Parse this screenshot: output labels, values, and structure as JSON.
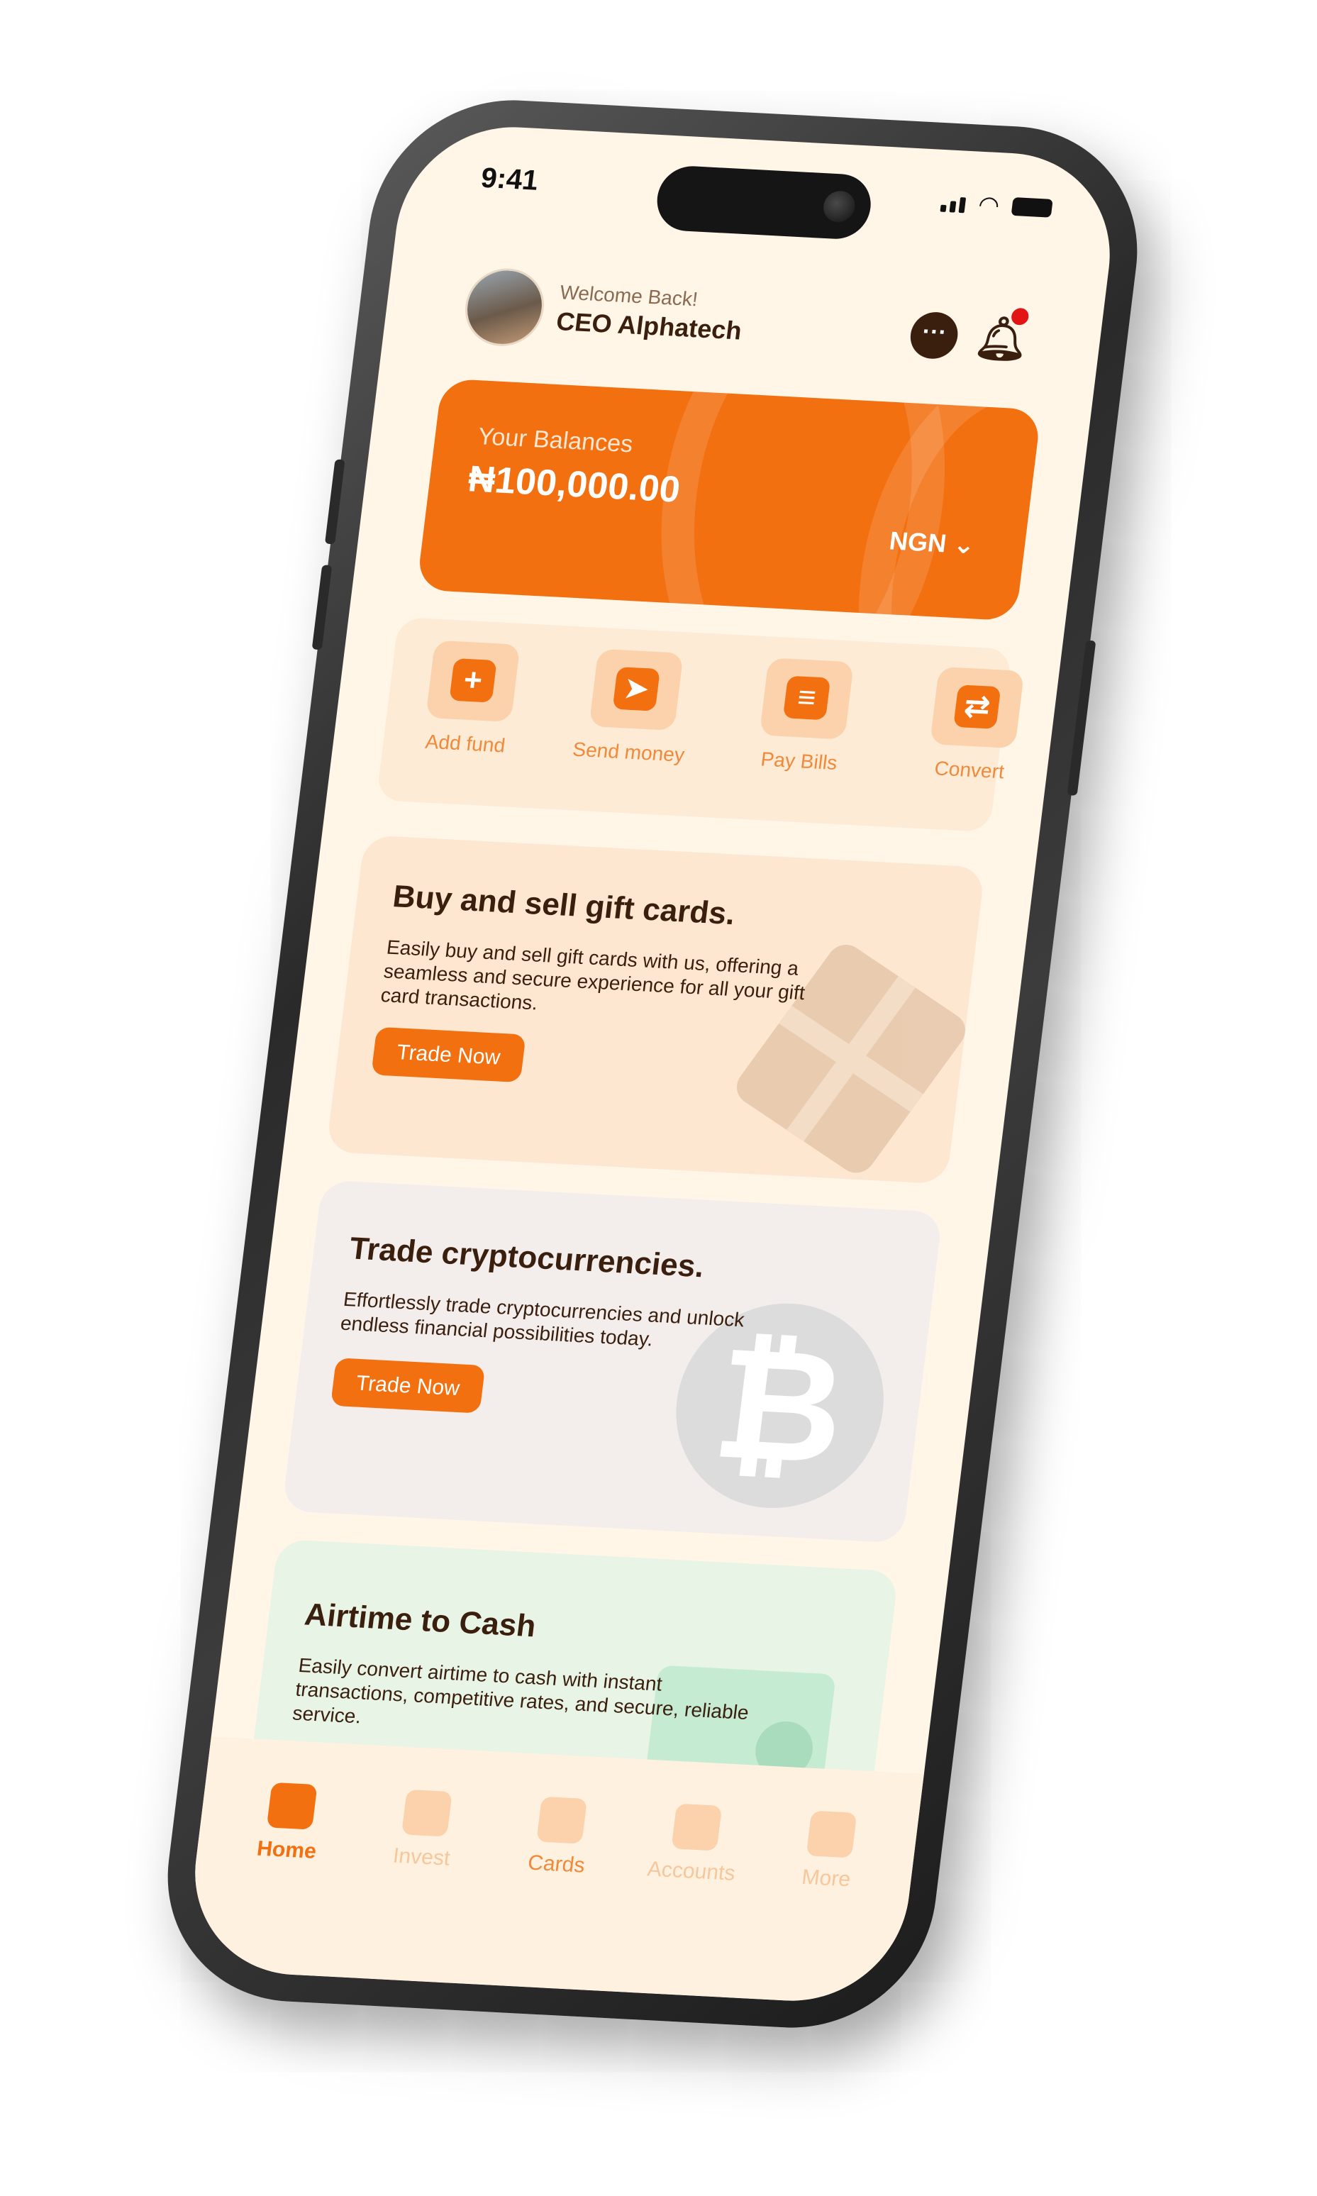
{
  "status": {
    "time": "9:41"
  },
  "header": {
    "welcome": "Welcome Back!",
    "username": "CEO Alphatech"
  },
  "balance": {
    "label": "Your Balances",
    "amount": "₦100,000.00",
    "currency": "NGN"
  },
  "actions": [
    {
      "label": "Add fund",
      "icon": "plus-icon",
      "glyph": "+"
    },
    {
      "label": "Send  money",
      "icon": "paper-plane-icon",
      "glyph": "➤"
    },
    {
      "label": "Pay Bills",
      "icon": "receipt-icon",
      "glyph": "≡"
    },
    {
      "label": "Convert",
      "icon": "convert-arrows-icon",
      "glyph": "⇄"
    }
  ],
  "cards": {
    "gift": {
      "title": "Buy and sell gift cards.",
      "desc": "Easily buy and sell gift cards with us, offering a seamless and secure experience for all your gift card transactions.",
      "button": "Trade Now"
    },
    "crypto": {
      "title": "Trade cryptocurrencies.",
      "desc": "Effortlessly trade cryptocurrencies and unlock endless financial possibilities today.",
      "button": "Trade Now",
      "symbol": "₿"
    },
    "airtime": {
      "title": "Airtime to Cash",
      "desc": "Easily convert airtime to cash with instant transactions, competitive rates, and secure, reliable service."
    }
  },
  "tabs": [
    {
      "label": "Home",
      "icon": "home-icon",
      "active": true
    },
    {
      "label": "Invest",
      "icon": "chart-icon",
      "active": false
    },
    {
      "label": "Cards",
      "icon": "card-icon",
      "active": false
    },
    {
      "label": "Accounts",
      "icon": "bank-icon",
      "active": false
    },
    {
      "label": "More",
      "icon": "grid-icon",
      "active": false
    }
  ],
  "colors": {
    "accent": "#f37010",
    "background": "#fff6e8",
    "text_dark": "#3a1f0e"
  }
}
